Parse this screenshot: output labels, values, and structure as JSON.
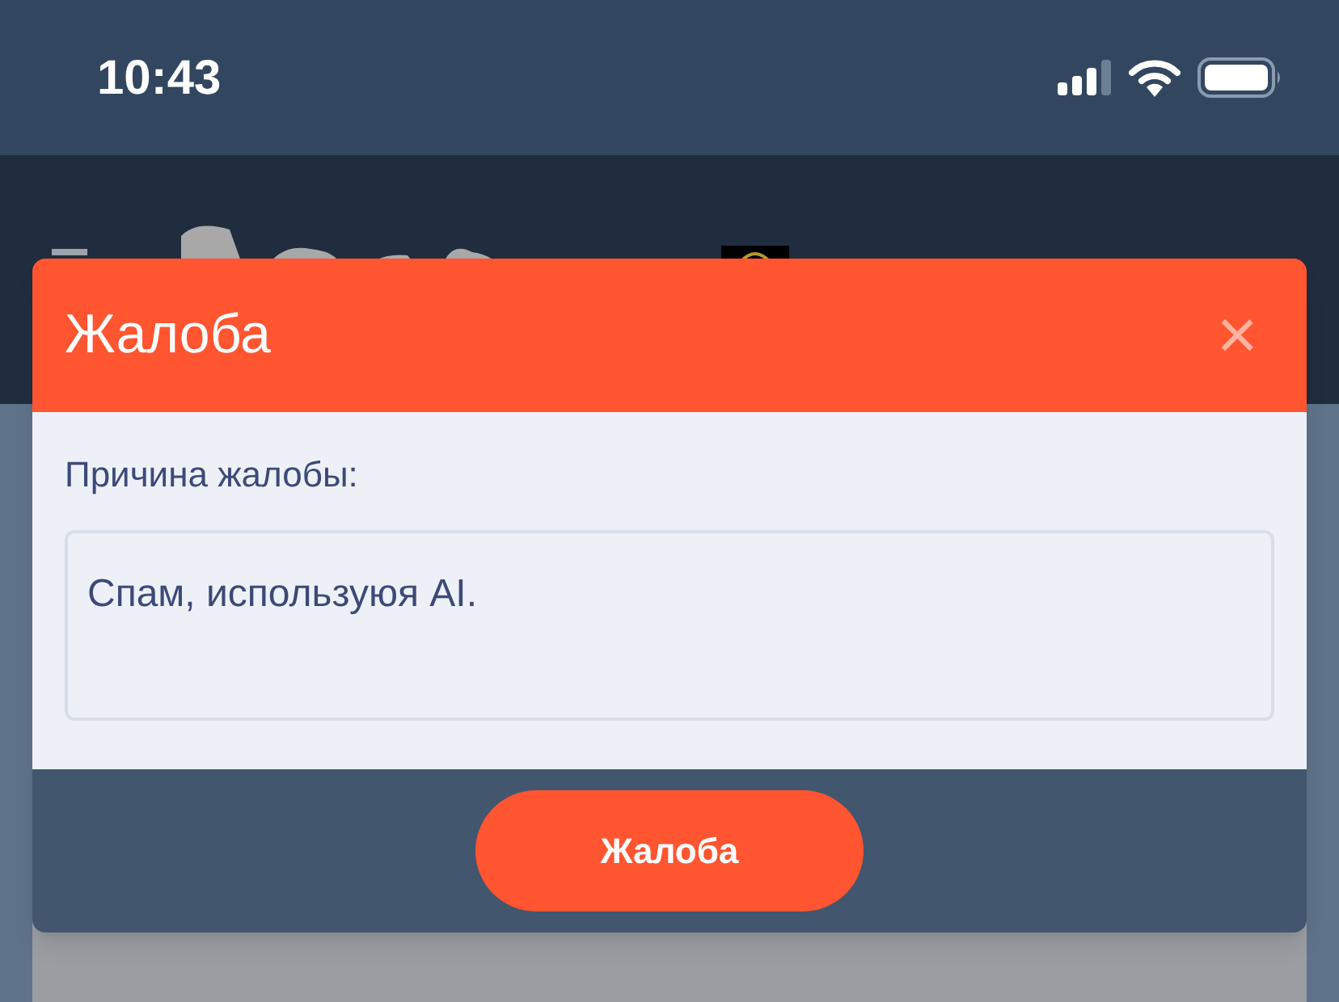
{
  "status_bar": {
    "time": "10:43"
  },
  "dialog": {
    "title": "Жалоба",
    "close": "×",
    "field_label": "Причина жалобы:",
    "reason": "Спам, используюя AI.",
    "submit": "Жалоба"
  }
}
